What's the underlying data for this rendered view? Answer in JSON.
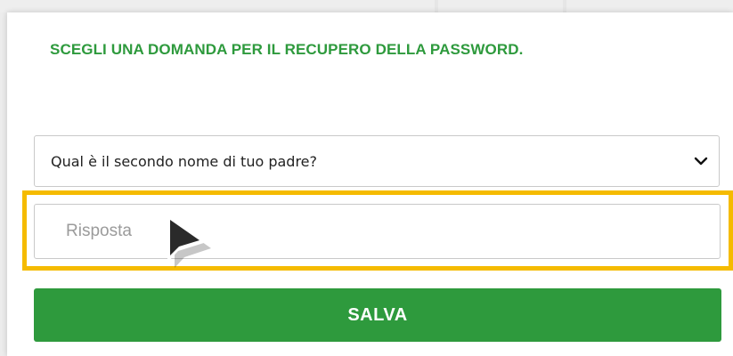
{
  "form": {
    "heading": "SCEGLI UNA DOMANDA PER IL RECUPERO DELLA PASSWORD.",
    "question_select": {
      "selected": "Qual è il secondo nome di tuo padre?"
    },
    "answer_input": {
      "placeholder": "Risposta",
      "value": ""
    },
    "save_label": "SALVA"
  },
  "icons": {
    "select_chevron": "chevron-down-icon",
    "pointer": "mouse-pointer-icon"
  },
  "colors": {
    "accent_green": "#2e9a3d",
    "highlight_yellow": "#f5bb00",
    "button_text": "#ffffff",
    "placeholder_gray": "#9b9b9b"
  }
}
